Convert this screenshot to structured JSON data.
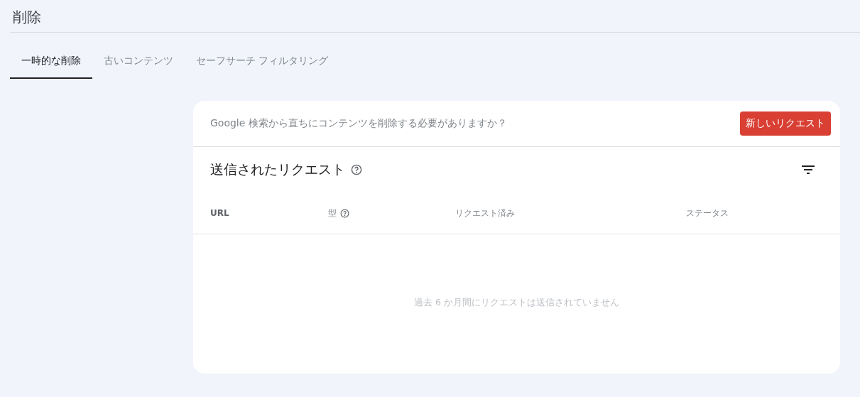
{
  "page_title": "削除",
  "tabs": [
    {
      "label": "一時的な削除",
      "selected": true
    },
    {
      "label": "古いコンテンツ",
      "selected": false
    },
    {
      "label": "セーフサーチ フィルタリング",
      "selected": false
    }
  ],
  "card": {
    "prompt": "Google 検索から直ちにコンテンツを削除する必要がありますか？",
    "new_request_button": "新しいリクエスト",
    "section_title": "送信されたリクエスト",
    "table": {
      "columns": [
        {
          "label": "URL",
          "help": false
        },
        {
          "label": "型",
          "help": true
        },
        {
          "label": "リクエスト済み",
          "help": false
        },
        {
          "label": "ステータス",
          "help": false
        }
      ],
      "empty_message": "過去 6 か月間にリクエストは送信されていません"
    }
  }
}
